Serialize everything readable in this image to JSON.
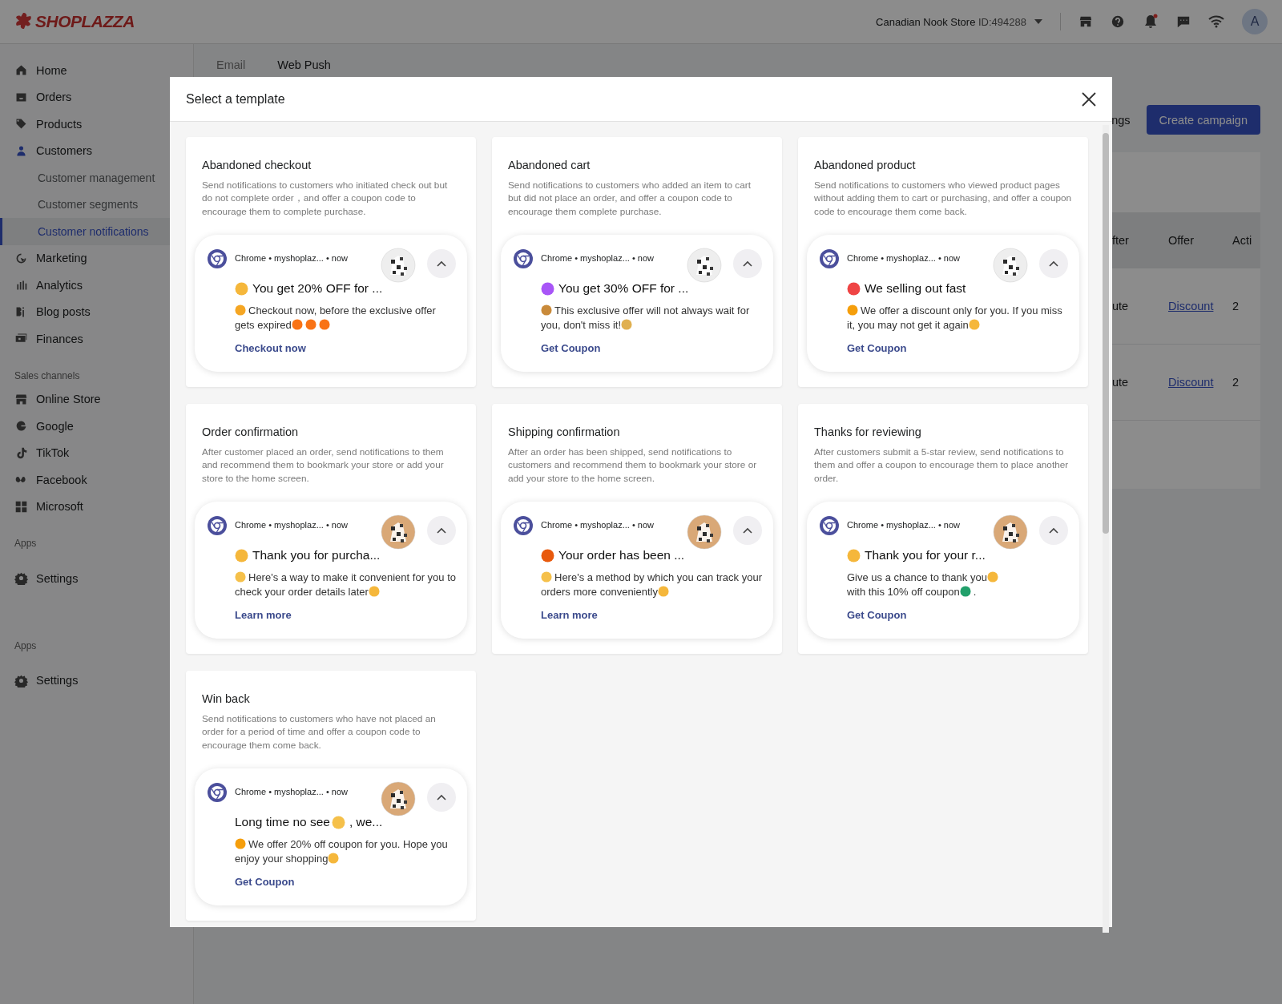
{
  "top_bar": {
    "logo": "SHOPLAZZA",
    "store_name": "Canadian Nook Store",
    "store_id": "ID:494288",
    "avatar": "A",
    "notification_dot": true
  },
  "sidebar": {
    "items": [
      {
        "kind": "nav",
        "label": "Home",
        "selected": false
      },
      {
        "kind": "nav",
        "label": "Orders",
        "selected": false
      },
      {
        "kind": "nav",
        "label": "Products",
        "selected": false
      },
      {
        "kind": "nav",
        "label": "Customers",
        "selected": true,
        "children": [
          {
            "label": "Customer management",
            "selected": false
          },
          {
            "label": "Customer segments",
            "selected": false
          },
          {
            "label": "Customer notifications",
            "selected": true
          }
        ]
      },
      {
        "kind": "nav",
        "label": "Marketing",
        "selected": false
      },
      {
        "kind": "nav",
        "label": "Analytics",
        "selected": false
      },
      {
        "kind": "nav",
        "label": "Blog posts",
        "selected": false
      },
      {
        "kind": "nav",
        "label": "Finances",
        "selected": false
      },
      {
        "kind": "section",
        "label": "Sales channels"
      },
      {
        "kind": "nav",
        "label": "Online Store",
        "selected": false
      },
      {
        "kind": "nav",
        "label": "Google",
        "selected": false
      },
      {
        "kind": "nav",
        "label": "TikTok",
        "selected": false
      },
      {
        "kind": "nav",
        "label": "Facebook",
        "selected": false
      },
      {
        "kind": "nav",
        "label": "Microsoft",
        "selected": false
      },
      {
        "kind": "section",
        "label": "Apps"
      },
      {
        "kind": "nav",
        "label": "Settings",
        "selected": false
      },
      {
        "kind": "section",
        "label": "Apps"
      },
      {
        "kind": "nav",
        "label": "Settings",
        "selected": false
      }
    ]
  },
  "main": {
    "tabs": [
      {
        "label": "Email",
        "selected": false
      },
      {
        "label": "Web Push",
        "selected": true
      }
    ],
    "buttons": [
      {
        "label": "ngs",
        "kind": "secondary"
      },
      {
        "label": "Create campaign",
        "kind": "primary"
      }
    ],
    "table": {
      "columns": [
        "fter",
        "Offer",
        "Acti"
      ],
      "rows": [
        [
          "ute",
          "Discount",
          "2"
        ],
        [
          "ute",
          "Discount",
          "2"
        ]
      ]
    }
  },
  "modal": {
    "title": "Select a template",
    "templates": [
      {
        "title": "Abandoned checkout",
        "description": "Send notifications to customers who initiated check out but do not complete order，and offer a coupon code to encourage them to complete purchase.",
        "notification": {
          "header": "Chrome • myshoplaz... • now",
          "title": [
            {
              "kind": "emoji",
              "color": "#f5b73b"
            },
            {
              "kind": "text",
              "text": "You get 20% OFF for ..."
            }
          ],
          "body": [
            {
              "kind": "emoji",
              "color": "#f5a623"
            },
            {
              "kind": "text",
              "text": "Checkout now, before the exclusive offer gets expired"
            },
            {
              "kind": "emoji",
              "color": "#f97316"
            },
            {
              "kind": "emoji",
              "color": "#f97316"
            },
            {
              "kind": "emoji",
              "color": "#f97316"
            }
          ],
          "link": "Checkout now"
        }
      },
      {
        "title": "Abandoned cart",
        "description": "Send notifications to customers who added an item to cart but did not place an order, and offer a coupon code to encourage them complete purchase.",
        "notification": {
          "header": "Chrome • myshoplaz... • now",
          "title": [
            {
              "kind": "emoji",
              "color": "#a855f7"
            },
            {
              "kind": "text",
              "text": "You get 30% OFF for ..."
            }
          ],
          "body": [
            {
              "kind": "emoji",
              "color": "#c98a3a"
            },
            {
              "kind": "text",
              "text": "This exclusive offer will not always wait for you, don't miss it!"
            },
            {
              "kind": "emoji",
              "color": "#e0b050"
            }
          ],
          "link": "Get Coupon"
        }
      },
      {
        "title": "Abandoned product",
        "description": "Send notifications to customers who viewed product pages without adding them to cart or purchasing, and offer a coupon code to encourage them come back.",
        "notification": {
          "header": "Chrome • myshoplaz... • now",
          "title": [
            {
              "kind": "emoji",
              "color": "#ef4444"
            },
            {
              "kind": "text",
              "text": "We selling out fast"
            }
          ],
          "body": [
            {
              "kind": "emoji",
              "color": "#f59e0b"
            },
            {
              "kind": "text",
              "text": "We offer a discount only for you. If you miss it, you may not get it again"
            },
            {
              "kind": "emoji",
              "color": "#f5b73b"
            }
          ],
          "link": "Get Coupon"
        }
      },
      {
        "title": "Order confirmation",
        "description": "After customer placed an order, send notifications to them and recommend them to bookmark your store or add your store to the home screen.",
        "notification": {
          "header": "Chrome • myshoplaz... • now",
          "title": [
            {
              "kind": "emoji",
              "color": "#f5b73b"
            },
            {
              "kind": "text",
              "text": "Thank you for purcha..."
            }
          ],
          "body": [
            {
              "kind": "emoji",
              "color": "#f5c04a"
            },
            {
              "kind": "text",
              "text": "Here's a way to make it convenient for you to check your order details later"
            },
            {
              "kind": "emoji",
              "color": "#f5b73b"
            }
          ],
          "link": "Learn more"
        }
      },
      {
        "title": "Shipping confirmation",
        "description": "After an order has been shipped, send notifications to customers and recommend them to bookmark your store or add your store to the home screen.",
        "notification": {
          "header": "Chrome • myshoplaz... • now",
          "title": [
            {
              "kind": "emoji",
              "color": "#e8590c"
            },
            {
              "kind": "text",
              "text": "Your order has been ..."
            }
          ],
          "body": [
            {
              "kind": "emoji",
              "color": "#f5c04a"
            },
            {
              "kind": "text",
              "text": "Here's a method by which you can track your orders more conveniently"
            },
            {
              "kind": "emoji",
              "color": "#f5b73b"
            }
          ],
          "link": "Learn more"
        }
      },
      {
        "title": "Thanks for reviewing",
        "description": "After customers submit a 5-star review, send notifications to them and offer a coupon to encourage them to place another order.",
        "notification": {
          "header": "Chrome • myshoplaz... • now",
          "title": [
            {
              "kind": "emoji",
              "color": "#f5b73b"
            },
            {
              "kind": "text",
              "text": "Thank you for your r..."
            }
          ],
          "body": [
            {
              "kind": "text",
              "text": "Give us a chance to thank you"
            },
            {
              "kind": "emoji",
              "color": "#f5b73b"
            },
            {
              "kind": "text",
              "text": " with this"
            },
            {
              "kind": "text",
              "text": " 10% off coupon"
            },
            {
              "kind": "emoji",
              "color": "#22a06b"
            },
            {
              "kind": "text",
              "text": "."
            }
          ],
          "link": "Get Coupon"
        }
      },
      {
        "title": "Win back",
        "description": "Send notifications to customers who have not placed an order for a period of time and offer a coupon code to encourage them come back.",
        "notification": {
          "header": "Chrome • myshoplaz... • now",
          "title": [
            {
              "kind": "text",
              "text": "Long time no see"
            },
            {
              "kind": "emoji",
              "color": "#f5c04a"
            },
            {
              "kind": "text",
              "text": ", we..."
            }
          ],
          "body": [
            {
              "kind": "emoji",
              "color": "#f59e0b"
            },
            {
              "kind": "text",
              "text": "We offer 20% off coupon for you. Hope you enjoy your shopping"
            },
            {
              "kind": "emoji",
              "color": "#f5b73b"
            }
          ],
          "link": "Get Coupon"
        }
      }
    ]
  }
}
